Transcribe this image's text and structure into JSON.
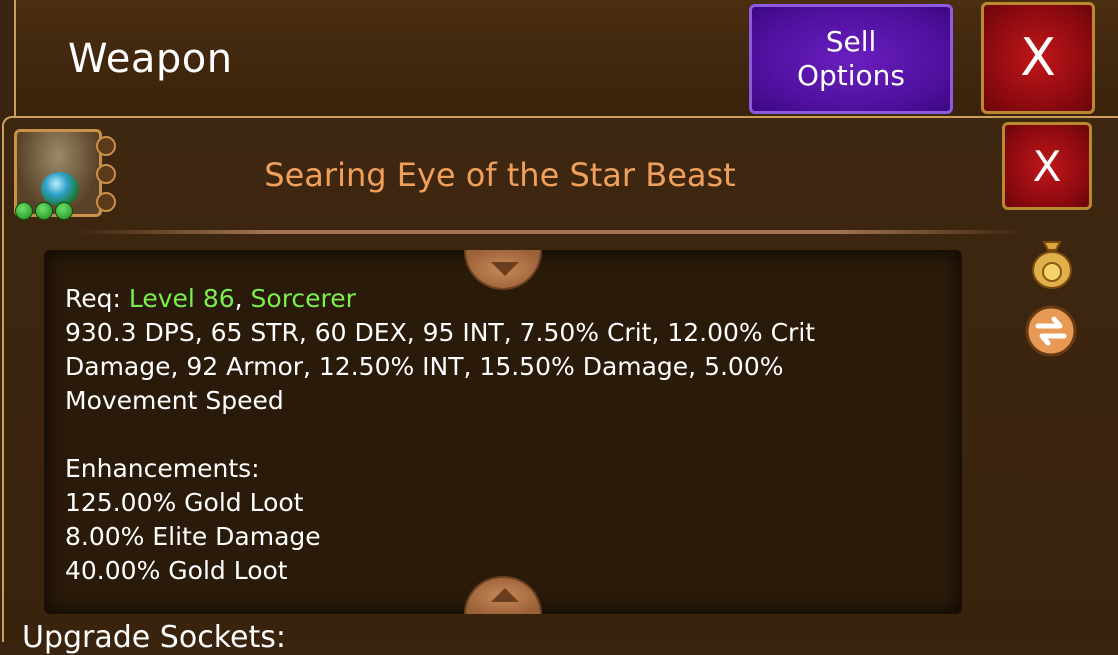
{
  "header": {
    "title": "Weapon",
    "sell_label_line1": "Sell",
    "sell_label_line2": "Options",
    "close_label": "X"
  },
  "item": {
    "name": "Searing Eye of the Star Beast",
    "close_label": "X",
    "req_prefix": "Req: ",
    "req_level": "Level 86",
    "req_sep": ", ",
    "req_class": "Sorcerer",
    "stats_line1": "930.3 DPS, 65 STR, 60 DEX, 95 INT, 7.50% Crit, 12.00% Crit",
    "stats_line2": "Damage, 92 Armor, 12.50% INT, 15.50% Damage, 5.00%",
    "stats_line3": "Movement Speed",
    "enhancements_title": "Enhancements:",
    "enhancements": [
      "125.00% Gold Loot",
      "8.00% Elite Damage",
      "40.00% Gold Loot"
    ]
  },
  "footer": {
    "upgrade_label": "Upgrade Sockets:"
  },
  "colors": {
    "item_name": "#f0a05a",
    "requirement_highlight": "#7aee4a",
    "sell_button": "#5a14b0",
    "close_button": "#a01015"
  },
  "icons": {
    "item": "gem-amulet-icon",
    "sell": "gold-bag-icon",
    "swap": "swap-arrows-icon",
    "scroll_up": "chevron-up-icon",
    "scroll_down": "chevron-down-icon"
  }
}
